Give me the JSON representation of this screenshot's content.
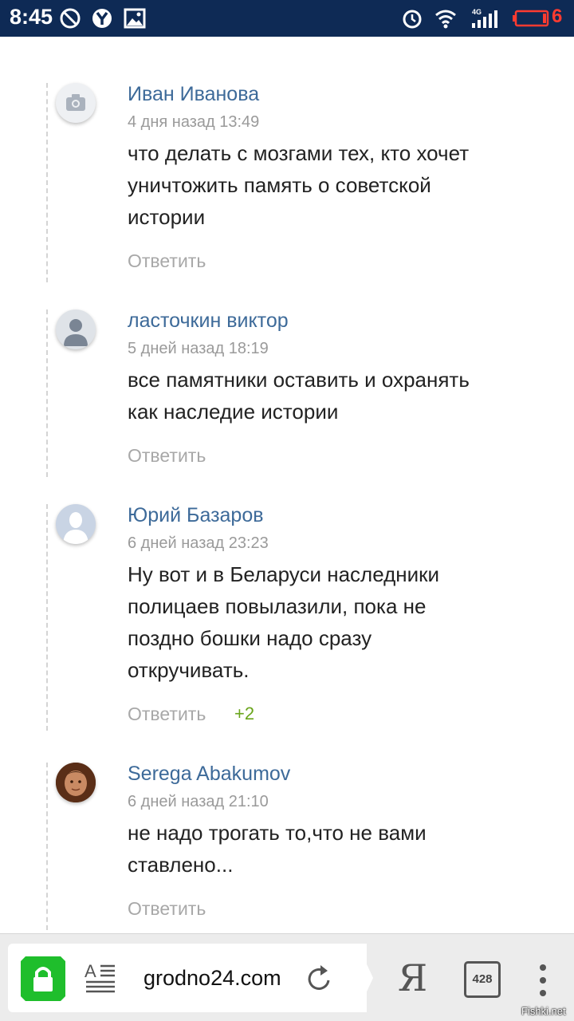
{
  "status_bar": {
    "time": "8:45",
    "network": "4G",
    "battery_level": "6",
    "icons": [
      "do-not-disturb-icon",
      "yandex-icon",
      "image-icon",
      "alarm-icon",
      "wifi-icon",
      "signal-icon",
      "battery-low-icon"
    ]
  },
  "comments": [
    {
      "author": "Иван Иванова",
      "date": "4 дня назад 13:49",
      "text": "что делать с мозгами тех, кто хочет уничтожить память о советской истории",
      "reply_label": "Ответить",
      "avatar": "camera-placeholder-icon"
    },
    {
      "author": "ласточкин виктор",
      "date": "5 дней назад 18:19",
      "text": "все памятники оставить и охранять как наследие истории",
      "reply_label": "Ответить",
      "avatar": "user-silhouette-icon"
    },
    {
      "author": "Юрий Базаров",
      "date": "6 дней назад 23:23",
      "text": "Ну вот и в Беларуси наследники полицаев повылазили, пока не поздно бошки надо сразу откручивать.",
      "reply_label": "Ответить",
      "votes": "+2",
      "avatar": "default-profile-icon"
    },
    {
      "author": "Serega Abakumov",
      "date": "6 дней назад 21:10",
      "text": "не надо трогать то,что не вами ставлено...",
      "reply_label": "Ответить",
      "avatar": "user-photo"
    }
  ],
  "browser": {
    "url": "grodno24.com",
    "tabs_count": "428",
    "yandex_label": "Я"
  },
  "watermark": "Fishki.net",
  "colors": {
    "status_bar": "#0e2a55",
    "author": "#3d6a99",
    "votes_positive": "#6aa51c",
    "lock_green": "#1fbe2c",
    "battery_red": "#ff3b30"
  }
}
